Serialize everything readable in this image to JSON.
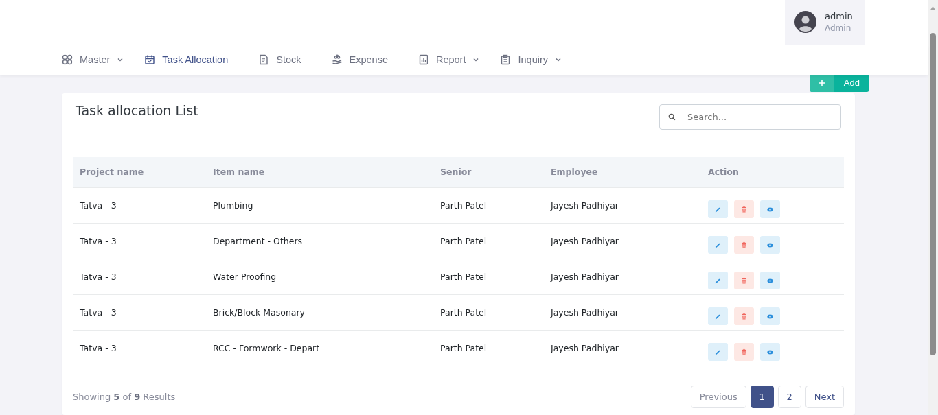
{
  "user": {
    "name": "admin",
    "role": "Admin"
  },
  "nav": [
    {
      "label": "Master",
      "dropdown": true,
      "selected": false
    },
    {
      "label": "Task Allocation",
      "dropdown": false,
      "selected": true
    },
    {
      "label": "Stock",
      "dropdown": false,
      "selected": false
    },
    {
      "label": "Expense",
      "dropdown": false,
      "selected": false
    },
    {
      "label": "Report",
      "dropdown": true,
      "selected": false
    },
    {
      "label": "Inquiry",
      "dropdown": true,
      "selected": false
    }
  ],
  "add_button": {
    "label": "Add"
  },
  "card": {
    "title": "Task allocation List",
    "search": {
      "placeholder": "Search..."
    }
  },
  "table": {
    "columns": [
      "Project name",
      "Item name",
      "Senior",
      "Employee",
      "Action"
    ],
    "rows": [
      [
        "Tatva - 3",
        "Plumbing",
        "Parth Patel",
        "Jayesh Padhiyar"
      ],
      [
        "Tatva - 3",
        "Department - Others",
        "Parth Patel",
        "Jayesh Padhiyar"
      ],
      [
        "Tatva - 3",
        "Water Proofing",
        "Parth Patel",
        "Jayesh Padhiyar"
      ],
      [
        "Tatva - 3",
        "Brick/Block Masonary",
        "Parth Patel",
        "Jayesh Padhiyar"
      ],
      [
        "Tatva - 3",
        "RCC - Formwork - Depart",
        "Parth Patel",
        "Jayesh Padhiyar"
      ]
    ]
  },
  "summary": "Showing **5** of **9** Results",
  "pagination": [
    {
      "label": "Previous",
      "kind": "nav",
      "selected": false
    },
    {
      "label": "1",
      "kind": "page",
      "selected": true
    },
    {
      "label": "2",
      "kind": "page",
      "selected": false
    },
    {
      "label": "Next",
      "kind": "nav",
      "selected": false
    }
  ]
}
